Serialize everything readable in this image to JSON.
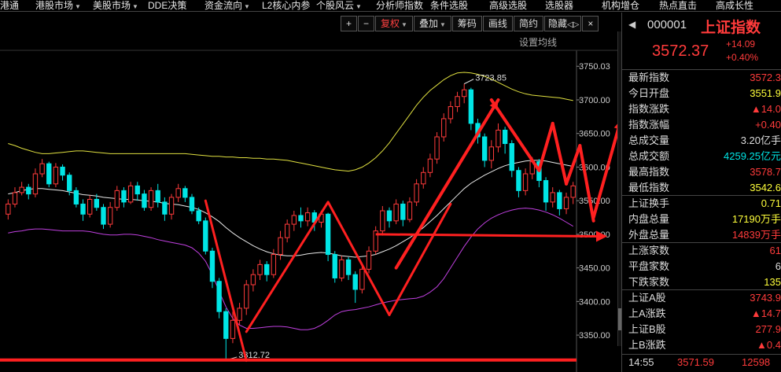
{
  "menu": [
    {
      "label": "港通",
      "caret": false
    },
    {
      "label": "港股市场",
      "caret": true
    },
    {
      "label": "美股市场",
      "caret": true
    },
    {
      "label": "DDE决策",
      "caret": false
    },
    {
      "label": "资金流向",
      "caret": true
    },
    {
      "label": "L2核心内参",
      "caret": false
    },
    {
      "label": "个股风云",
      "caret": true
    },
    {
      "label": "分析师指数",
      "caret": false
    },
    {
      "label": "条件选股",
      "caret": false
    },
    {
      "label": "高级选股",
      "caret": false
    },
    {
      "label": "选股器",
      "caret": false
    },
    {
      "label": "机构增仓",
      "caret": false
    },
    {
      "label": "热点直击",
      "caret": false
    },
    {
      "label": "高成长性",
      "caret": false
    }
  ],
  "toolbar": {
    "plus": "+",
    "minus": "−",
    "fuquan": "复权",
    "diejia": "叠加",
    "chouma": "筹码",
    "huaxian": "画线",
    "jianyue": "简约",
    "yincang": "隐藏",
    "nav_left": "◁",
    "nav_right": "▷",
    "close": "×",
    "ma_setting": "设置均线"
  },
  "chart_data": {
    "type": "candlestick",
    "yticks": [
      3350,
      3400,
      3450,
      3500,
      3550,
      3600,
      3650,
      3700,
      3750.03
    ],
    "ytick_labels": [
      "3350.00",
      "3400.00",
      "3450.00",
      "3500.00",
      "3550.00",
      "3600.00",
      "3650.00",
      "3700.00",
      "3750.03"
    ],
    "ylim": [
      3315,
      3755
    ],
    "high_label": "3723.85",
    "low_label": "3312.72",
    "high_value": 3723.85,
    "low_value": 3312.72,
    "candles": [
      {
        "o": 3530,
        "c": 3545,
        "h": 3552,
        "l": 3522,
        "up": true
      },
      {
        "o": 3545,
        "c": 3562,
        "h": 3570,
        "l": 3540,
        "up": true
      },
      {
        "o": 3562,
        "c": 3570,
        "h": 3578,
        "l": 3558,
        "up": true
      },
      {
        "o": 3570,
        "c": 3560,
        "h": 3575,
        "l": 3552,
        "up": false
      },
      {
        "o": 3560,
        "c": 3590,
        "h": 3598,
        "l": 3555,
        "up": true
      },
      {
        "o": 3590,
        "c": 3605,
        "h": 3612,
        "l": 3585,
        "up": true
      },
      {
        "o": 3605,
        "c": 3575,
        "h": 3608,
        "l": 3570,
        "up": false
      },
      {
        "o": 3575,
        "c": 3600,
        "h": 3606,
        "l": 3570,
        "up": true
      },
      {
        "o": 3600,
        "c": 3588,
        "h": 3604,
        "l": 3580,
        "up": false
      },
      {
        "o": 3588,
        "c": 3565,
        "h": 3592,
        "l": 3558,
        "up": false
      },
      {
        "o": 3565,
        "c": 3545,
        "h": 3570,
        "l": 3540,
        "up": false
      },
      {
        "o": 3545,
        "c": 3530,
        "h": 3552,
        "l": 3520,
        "up": false
      },
      {
        "o": 3530,
        "c": 3552,
        "h": 3558,
        "l": 3525,
        "up": true
      },
      {
        "o": 3552,
        "c": 3540,
        "h": 3560,
        "l": 3535,
        "up": false
      },
      {
        "o": 3540,
        "c": 3515,
        "h": 3545,
        "l": 3508,
        "up": false
      },
      {
        "o": 3515,
        "c": 3540,
        "h": 3548,
        "l": 3510,
        "up": true
      },
      {
        "o": 3540,
        "c": 3565,
        "h": 3572,
        "l": 3535,
        "up": true
      },
      {
        "o": 3565,
        "c": 3548,
        "h": 3570,
        "l": 3540,
        "up": false
      },
      {
        "o": 3548,
        "c": 3572,
        "h": 3578,
        "l": 3545,
        "up": true
      },
      {
        "o": 3572,
        "c": 3560,
        "h": 3578,
        "l": 3550,
        "up": false
      },
      {
        "o": 3560,
        "c": 3540,
        "h": 3566,
        "l": 3535,
        "up": false
      },
      {
        "o": 3540,
        "c": 3565,
        "h": 3570,
        "l": 3535,
        "up": true
      },
      {
        "o": 3565,
        "c": 3548,
        "h": 3575,
        "l": 3540,
        "up": false
      },
      {
        "o": 3548,
        "c": 3530,
        "h": 3555,
        "l": 3520,
        "up": false
      },
      {
        "o": 3530,
        "c": 3555,
        "h": 3560,
        "l": 3522,
        "up": true
      },
      {
        "o": 3555,
        "c": 3568,
        "h": 3575,
        "l": 3548,
        "up": true
      },
      {
        "o": 3568,
        "c": 3555,
        "h": 3572,
        "l": 3548,
        "up": false
      },
      {
        "o": 3555,
        "c": 3535,
        "h": 3560,
        "l": 3530,
        "up": false
      },
      {
        "o": 3535,
        "c": 3520,
        "h": 3540,
        "l": 3515,
        "up": false
      },
      {
        "o": 3520,
        "c": 3475,
        "h": 3525,
        "l": 3470,
        "up": false
      },
      {
        "o": 3475,
        "c": 3430,
        "h": 3480,
        "l": 3420,
        "up": false
      },
      {
        "o": 3430,
        "c": 3385,
        "h": 3435,
        "l": 3375,
        "up": false
      },
      {
        "o": 3385,
        "c": 3345,
        "h": 3390,
        "l": 3312.72,
        "up": false
      },
      {
        "o": 3345,
        "c": 3372,
        "h": 3385,
        "l": 3338,
        "up": true
      },
      {
        "o": 3372,
        "c": 3390,
        "h": 3398,
        "l": 3365,
        "up": true
      },
      {
        "o": 3390,
        "c": 3425,
        "h": 3432,
        "l": 3380,
        "up": true
      },
      {
        "o": 3425,
        "c": 3440,
        "h": 3448,
        "l": 3415,
        "up": true
      },
      {
        "o": 3440,
        "c": 3455,
        "h": 3462,
        "l": 3432,
        "up": true
      },
      {
        "o": 3455,
        "c": 3440,
        "h": 3460,
        "l": 3430,
        "up": false
      },
      {
        "o": 3440,
        "c": 3470,
        "h": 3478,
        "l": 3435,
        "up": true
      },
      {
        "o": 3470,
        "c": 3495,
        "h": 3505,
        "l": 3462,
        "up": true
      },
      {
        "o": 3495,
        "c": 3515,
        "h": 3522,
        "l": 3488,
        "up": true
      },
      {
        "o": 3515,
        "c": 3528,
        "h": 3535,
        "l": 3505,
        "up": true
      },
      {
        "o": 3528,
        "c": 3520,
        "h": 3540,
        "l": 3510,
        "up": false
      },
      {
        "o": 3520,
        "c": 3532,
        "h": 3540,
        "l": 3512,
        "up": true
      },
      {
        "o": 3532,
        "c": 3518,
        "h": 3536,
        "l": 3505,
        "up": false
      },
      {
        "o": 3518,
        "c": 3530,
        "h": 3535,
        "l": 3510,
        "up": true
      },
      {
        "o": 3530,
        "c": 3470,
        "h": 3532,
        "l": 3460,
        "up": false
      },
      {
        "o": 3470,
        "c": 3435,
        "h": 3475,
        "l": 3428,
        "up": false
      },
      {
        "o": 3435,
        "c": 3462,
        "h": 3468,
        "l": 3430,
        "up": true
      },
      {
        "o": 3462,
        "c": 3440,
        "h": 3466,
        "l": 3432,
        "up": false
      },
      {
        "o": 3440,
        "c": 3418,
        "h": 3445,
        "l": 3398,
        "up": false
      },
      {
        "o": 3418,
        "c": 3448,
        "h": 3455,
        "l": 3412,
        "up": true
      },
      {
        "o": 3448,
        "c": 3475,
        "h": 3482,
        "l": 3442,
        "up": true
      },
      {
        "o": 3475,
        "c": 3505,
        "h": 3512,
        "l": 3470,
        "up": true
      },
      {
        "o": 3505,
        "c": 3535,
        "h": 3542,
        "l": 3498,
        "up": true
      },
      {
        "o": 3535,
        "c": 3520,
        "h": 3540,
        "l": 3510,
        "up": false
      },
      {
        "o": 3520,
        "c": 3545,
        "h": 3552,
        "l": 3515,
        "up": true
      },
      {
        "o": 3545,
        "c": 3522,
        "h": 3550,
        "l": 3512,
        "up": false
      },
      {
        "o": 3522,
        "c": 3548,
        "h": 3555,
        "l": 3518,
        "up": true
      },
      {
        "o": 3548,
        "c": 3575,
        "h": 3582,
        "l": 3542,
        "up": true
      },
      {
        "o": 3575,
        "c": 3592,
        "h": 3600,
        "l": 3568,
        "up": true
      },
      {
        "o": 3592,
        "c": 3612,
        "h": 3620,
        "l": 3585,
        "up": true
      },
      {
        "o": 3612,
        "c": 3645,
        "h": 3652,
        "l": 3605,
        "up": true
      },
      {
        "o": 3645,
        "c": 3672,
        "h": 3680,
        "l": 3638,
        "up": true
      },
      {
        "o": 3672,
        "c": 3690,
        "h": 3698,
        "l": 3665,
        "up": true
      },
      {
        "o": 3690,
        "c": 3705,
        "h": 3712,
        "l": 3682,
        "up": true
      },
      {
        "o": 3705,
        "c": 3715,
        "h": 3723.85,
        "l": 3695,
        "up": true
      },
      {
        "o": 3715,
        "c": 3665,
        "h": 3718,
        "l": 3655,
        "up": false
      },
      {
        "o": 3665,
        "c": 3645,
        "h": 3672,
        "l": 3635,
        "up": false
      },
      {
        "o": 3645,
        "c": 3610,
        "h": 3650,
        "l": 3600,
        "up": false
      },
      {
        "o": 3610,
        "c": 3630,
        "h": 3640,
        "l": 3598,
        "up": true
      },
      {
        "o": 3630,
        "c": 3655,
        "h": 3665,
        "l": 3622,
        "up": true
      },
      {
        "o": 3655,
        "c": 3635,
        "h": 3660,
        "l": 3620,
        "up": false
      },
      {
        "o": 3635,
        "c": 3595,
        "h": 3640,
        "l": 3585,
        "up": false
      },
      {
        "o": 3595,
        "c": 3565,
        "h": 3600,
        "l": 3555,
        "up": false
      },
      {
        "o": 3565,
        "c": 3590,
        "h": 3598,
        "l": 3558,
        "up": true
      },
      {
        "o": 3590,
        "c": 3608,
        "h": 3615,
        "l": 3582,
        "up": true
      },
      {
        "o": 3608,
        "c": 3580,
        "h": 3612,
        "l": 3570,
        "up": false
      },
      {
        "o": 3580,
        "c": 3548,
        "h": 3585,
        "l": 3535,
        "up": false
      },
      {
        "o": 3548,
        "c": 3562,
        "h": 3570,
        "l": 3540,
        "up": true
      },
      {
        "o": 3562,
        "c": 3538,
        "h": 3566,
        "l": 3528,
        "up": false
      },
      {
        "o": 3538,
        "c": 3555,
        "h": 3562,
        "l": 3530,
        "up": true
      },
      {
        "o": 3555,
        "c": 3572,
        "h": 3578,
        "l": 3545,
        "up": true
      }
    ],
    "ma_mid": [
      3560,
      3562,
      3565,
      3567,
      3568,
      3568,
      3567,
      3566,
      3565,
      3563,
      3561,
      3559,
      3558,
      3557,
      3555,
      3554,
      3553,
      3552,
      3552,
      3551,
      3550,
      3549,
      3548,
      3546,
      3545,
      3544,
      3542,
      3540,
      3537,
      3532,
      3526,
      3519,
      3510,
      3502,
      3495,
      3489,
      3483,
      3478,
      3474,
      3471,
      3469,
      3468,
      3468,
      3469,
      3471,
      3472,
      3473,
      3472,
      3470,
      3468,
      3467,
      3466,
      3467,
      3468,
      3470,
      3474,
      3478,
      3483,
      3489,
      3495,
      3502,
      3510,
      3519,
      3528,
      3538,
      3548,
      3558,
      3568,
      3576,
      3582,
      3588,
      3593,
      3598,
      3602,
      3605,
      3607,
      3609,
      3610,
      3610,
      3609,
      3607,
      3605,
      3603,
      3601
    ],
    "ma_upper": [
      3635,
      3632,
      3628,
      3625,
      3622,
      3620,
      3620,
      3621,
      3622,
      3623,
      3624,
      3624,
      3623,
      3622,
      3621,
      3620,
      3620,
      3620,
      3620,
      3620,
      3620,
      3620,
      3620,
      3620,
      3620,
      3620,
      3620,
      3619,
      3618,
      3617,
      3616,
      3616,
      3615,
      3615,
      3614,
      3614,
      3613,
      3613,
      3612,
      3612,
      3611,
      3610,
      3608,
      3606,
      3604,
      3602,
      3600,
      3598,
      3596,
      3595,
      3594,
      3596,
      3600,
      3606,
      3614,
      3624,
      3636,
      3650,
      3664,
      3678,
      3692,
      3704,
      3714,
      3722,
      3730,
      3736,
      3740,
      3741,
      3740,
      3738,
      3735,
      3731,
      3726,
      3721,
      3716,
      3712,
      3709,
      3707,
      3706,
      3705,
      3704,
      3703,
      3701,
      3699
    ],
    "ma_lower": [
      3502,
      3504,
      3505,
      3507,
      3508,
      3508,
      3507,
      3506,
      3505,
      3505,
      3505,
      3505,
      3504,
      3502,
      3500,
      3499,
      3499,
      3500,
      3500,
      3499,
      3497,
      3495,
      3492,
      3490,
      3488,
      3486,
      3484,
      3480,
      3472,
      3460,
      3440,
      3415,
      3392,
      3375,
      3365,
      3360,
      3360,
      3361,
      3362,
      3363,
      3363,
      3362,
      3360,
      3358,
      3358,
      3360,
      3365,
      3372,
      3380,
      3385,
      3387,
      3388,
      3390,
      3392,
      3395,
      3398,
      3400,
      3402,
      3403,
      3404,
      3405,
      3408,
      3414,
      3422,
      3434,
      3450,
      3466,
      3482,
      3496,
      3508,
      3517,
      3524,
      3529,
      3533,
      3536,
      3538,
      3539,
      3538,
      3536,
      3533,
      3529,
      3524,
      3518,
      3512
    ]
  },
  "panel": {
    "code": "000001",
    "name": "上证指数",
    "price": "3572.37",
    "change": "+14.09",
    "change_pct": "+0.40%",
    "stats": [
      {
        "label": "最新指数",
        "value": "3572.3",
        "color": "red"
      },
      {
        "label": "今日开盘",
        "value": "3551.9",
        "color": "yellow"
      },
      {
        "label": "指数涨跌",
        "value": "▲14.0",
        "color": "red"
      },
      {
        "label": "指数涨幅",
        "value": "+0.40",
        "color": "red"
      },
      {
        "label": "总成交量",
        "value": "3.20亿手",
        "color": "white"
      },
      {
        "label": "总成交额",
        "value": "4259.25亿元",
        "color": "green"
      },
      {
        "label": "最高指数",
        "value": "3578.7",
        "color": "red"
      },
      {
        "label": "最低指数",
        "value": "3542.6",
        "color": "yellow"
      }
    ],
    "vol_stats": [
      {
        "label": "上证换手",
        "value": "0.71",
        "color": "yellow"
      },
      {
        "label": "内盘总量",
        "value": "17190万手",
        "color": "yellow"
      },
      {
        "label": "外盘总量",
        "value": "14839万手",
        "color": "red"
      }
    ],
    "breadth": [
      {
        "label": "上涨家数",
        "value": "61",
        "color": "red"
      },
      {
        "label": "平盘家数",
        "value": "6",
        "color": "white"
      },
      {
        "label": "下跌家数",
        "value": "135",
        "color": "yellow"
      }
    ],
    "shares": [
      {
        "label": "上证A股",
        "value": "3743.9",
        "color": "red"
      },
      {
        "label": "上A涨跌",
        "value": "▲14.7",
        "color": "red"
      },
      {
        "label": "上证B股",
        "value": "277.9",
        "color": "red"
      },
      {
        "label": "上B涨跌",
        "value": "▲0.4",
        "color": "red"
      }
    ],
    "tick": {
      "time": "14:55",
      "price": "3571.59",
      "volume": "12598"
    }
  },
  "colors": {
    "up": "#ff3b3b",
    "down": "#00e5e5",
    "ma_mid": "#e8e8e8",
    "ma_upper": "#e0e040",
    "ma_lower": "#c040e0",
    "annot": "#ff2020"
  }
}
